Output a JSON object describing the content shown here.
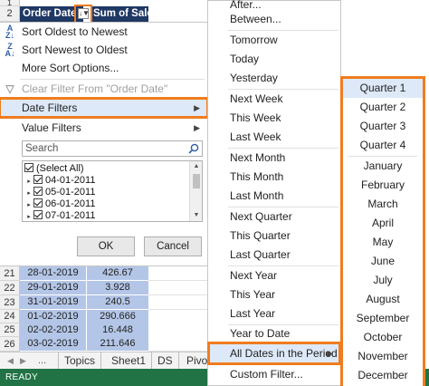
{
  "header": {
    "order_date": "Order Date",
    "sum_of_sales": "Sum of Sales",
    "filter_arrow": "↓▼"
  },
  "row_numbers": {
    "top": [
      "1",
      "2"
    ],
    "bottom": [
      "21",
      "22",
      "23",
      "24",
      "25",
      "26"
    ]
  },
  "rows": [
    {
      "date": "28-01-2019",
      "sales": "426.67"
    },
    {
      "date": "29-01-2019",
      "sales": "3.928"
    },
    {
      "date": "31-01-2019",
      "sales": "240.5"
    },
    {
      "date": "01-02-2019",
      "sales": "290.666"
    },
    {
      "date": "02-02-2019",
      "sales": "16.448"
    },
    {
      "date": "03-02-2019",
      "sales": "211.646"
    }
  ],
  "filter_menu": {
    "sort_oldest": "Sort Oldest to Newest",
    "sort_newest": "Sort Newest to Oldest",
    "more_sort": "More Sort Options...",
    "clear_filter": "Clear Filter From \"Order Date\"",
    "date_filters": "Date Filters",
    "value_filters": "Value Filters",
    "search_placeholder": "Search",
    "tree_items": [
      "(Select All)",
      "04-01-2011",
      "05-01-2011",
      "06-01-2011",
      "07-01-2011"
    ],
    "ok": "OK",
    "cancel": "Cancel",
    "icons": {
      "sort_asc": "sort-ascending-icon",
      "sort_desc": "sort-descending-icon",
      "clear": "clear-filter-icon"
    }
  },
  "date_submenu": {
    "items": [
      "After...",
      "Between...",
      "Tomorrow",
      "Today",
      "Yesterday",
      "Next Week",
      "This Week",
      "Last Week",
      "Next Month",
      "This Month",
      "Last Month",
      "Next Quarter",
      "This Quarter",
      "Last Quarter",
      "Next Year",
      "This Year",
      "Last Year",
      "Year to Date",
      "All Dates in the Period",
      "Custom Filter..."
    ]
  },
  "period_menu": {
    "items": [
      "Quarter 1",
      "Quarter 2",
      "Quarter 3",
      "Quarter 4",
      "January",
      "February",
      "March",
      "April",
      "May",
      "June",
      "July",
      "August",
      "September",
      "October",
      "November",
      "December"
    ]
  },
  "sheet_tabs": [
    "Topics",
    "Sheet1",
    "DS",
    "Pivo"
  ],
  "status": {
    "ready": "READY"
  },
  "colors": {
    "highlight": "#f07c1e",
    "header_bg": "#1f3864",
    "data_bg": "#b4c6e7",
    "status_bar": "#217346",
    "hover_bg": "#dde9f8"
  }
}
